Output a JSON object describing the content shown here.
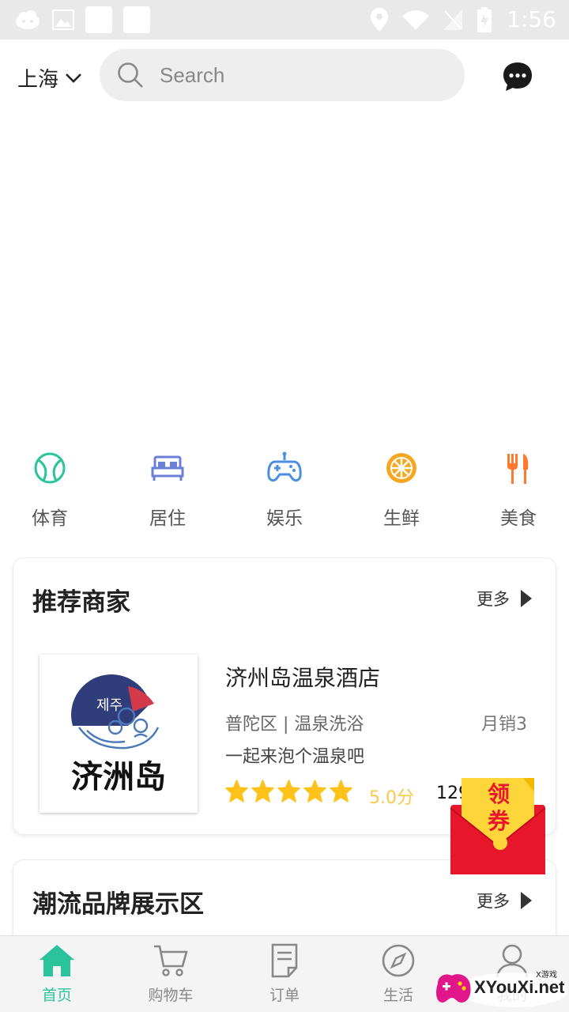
{
  "status_bar": {
    "time": "1:56"
  },
  "header": {
    "city": "上海",
    "search_placeholder": "Search"
  },
  "categories": [
    {
      "label": "体育",
      "icon": "sports-ball-icon",
      "color": "#2bc49a"
    },
    {
      "label": "居住",
      "icon": "bed-icon",
      "color": "#6b7fd6"
    },
    {
      "label": "娱乐",
      "icon": "gamepad-icon",
      "color": "#4a8fe0"
    },
    {
      "label": "生鲜",
      "icon": "orange-slice-icon",
      "color": "#f5a623"
    },
    {
      "label": "美食",
      "icon": "fork-knife-icon",
      "color": "#ff7a2e"
    }
  ],
  "recommended": {
    "title": "推荐商家",
    "more_label": "更多",
    "shop": {
      "name": "济州岛温泉酒店",
      "area": "普陀区 | 温泉洗浴",
      "sales": "月销3",
      "desc": "一起来泡个温泉吧",
      "rating_stars": 5,
      "rating_text": "5.0分",
      "price": "129",
      "logo_text": "济洲岛"
    }
  },
  "trend": {
    "title": "潮流品牌展示区",
    "more_label": "更多"
  },
  "coupon": {
    "line1": "领",
    "line2": "券"
  },
  "bottom_nav": [
    {
      "label": "首页",
      "icon": "home-icon",
      "active": true
    },
    {
      "label": "购物车",
      "icon": "cart-icon",
      "active": false
    },
    {
      "label": "订单",
      "icon": "order-icon",
      "active": false
    },
    {
      "label": "生活",
      "icon": "compass-icon",
      "active": false
    },
    {
      "label": "我的",
      "icon": "user-icon",
      "active": false
    }
  ],
  "watermark": {
    "text": "XYouXi.net",
    "small": "X游戏"
  },
  "colors": {
    "accent": "#2bc49a",
    "star": "#ffc21a",
    "rating": "#f7c94a",
    "coupon_red": "#e8162b"
  }
}
